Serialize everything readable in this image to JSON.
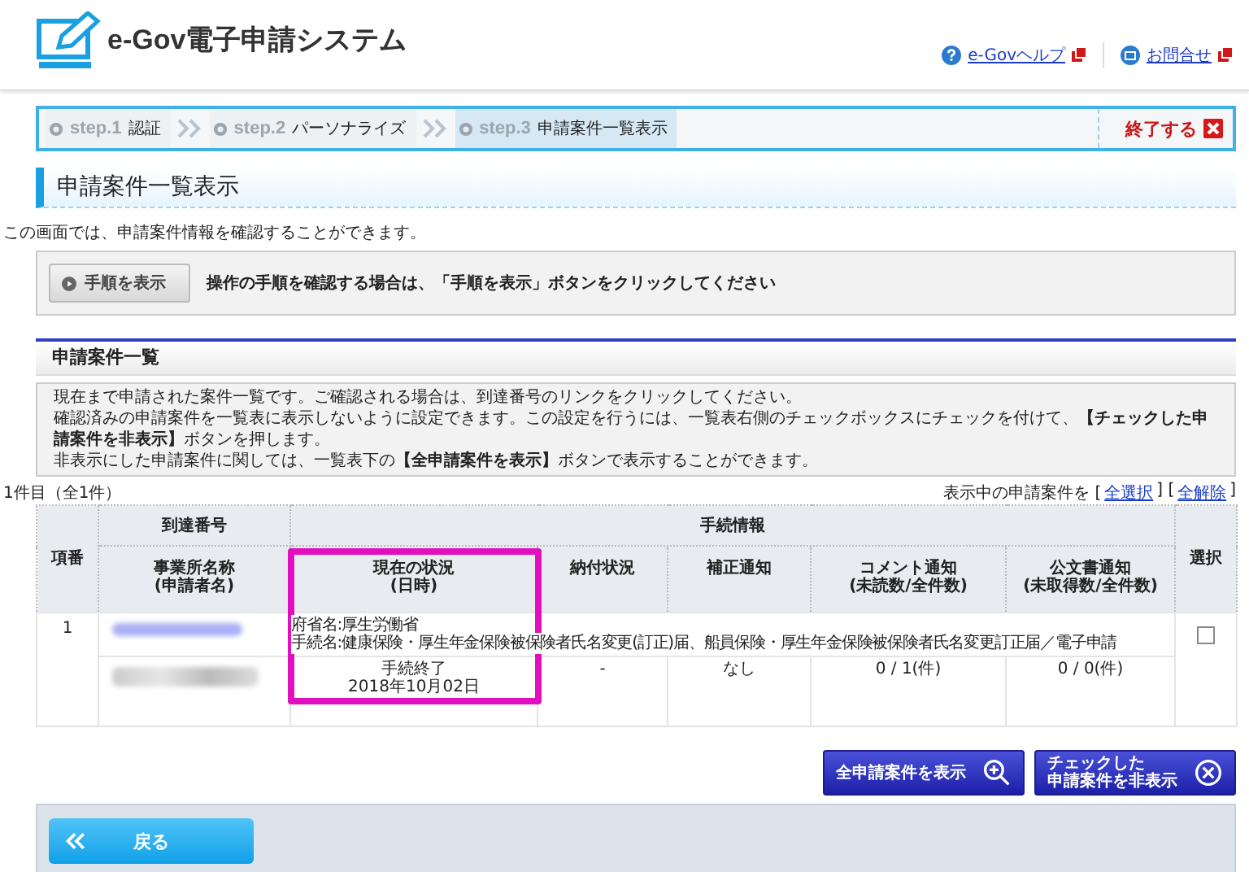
{
  "header": {
    "logo_text": "e-Gov電子申請システム",
    "links": [
      {
        "label": "e-Govヘルプ",
        "kind": "help"
      },
      {
        "label": "お問合せ",
        "kind": "mail"
      }
    ]
  },
  "steps": [
    {
      "number": "step.1",
      "label": "認証",
      "selected": false
    },
    {
      "number": "step.2",
      "label": "パーソナライズ",
      "selected": false
    },
    {
      "number": "step.3",
      "label": "申請案件一覧表示",
      "selected": true
    }
  ],
  "exit_button": "終了する",
  "page_title": "申請案件一覧表示",
  "intro": "この画面では、申請案件情報を確認することができます。",
  "guide": {
    "button": "手順を表示",
    "text": "操作の手順を確認する場合は、「手順を表示」ボタンをクリックしてください"
  },
  "section_title": "申請案件一覧",
  "notice": [
    "現在まで申請された案件一覧です。ご確認される場合は、到達番号のリンクをクリックしてください。",
    "確認済みの申請案件を一覧表に表示しないように設定できます。この設定を行うには、一覧表右側のチェックボックスにチェックを付けて、**【チェックした申請案件を非表示】**ボタンを押します。",
    "非表示にした申請案件に関しては、一覧表下の**【全申請案件を表示】**ボタンで表示することができます。"
  ],
  "count": "1件目（全1件）",
  "selection": {
    "prefix": "表示中の申請案件を [",
    "select_all": "全選択",
    "middle": "] [",
    "clear_all": "全解除",
    "suffix": "]"
  },
  "table": {
    "col_index": "項番",
    "col_arrival": "到達番号",
    "col_procedure": "手続情報",
    "col_select": "選択",
    "sub_columns": [
      "事業所名称\n(申請者名)",
      "現在の状況\n(日時)",
      "納付状況",
      "補正通知",
      "コメント通知\n(未読数/全件数)",
      "公文書通知\n(未取得数/全件数)"
    ],
    "rows": [
      {
        "index": "1",
        "procedure_lines": [
          "府省名:厚生労働省",
          "手続名:健康保険・厚生年金保険被保険者氏名変更(訂正)届、船員保険・厚生年金保険被保険者氏名変更訂正届／電子申請"
        ],
        "cells": [
          "手続終了\n2018年10月02日",
          "-",
          "なし",
          "0 / 1(件)",
          "0 / 0(件)"
        ],
        "checked": false
      }
    ]
  },
  "actions": [
    {
      "label": "全申請案件を表示",
      "kind": "zoom"
    },
    {
      "label": "チェックした",
      "label_2": "申請案件を非表示",
      "kind": "hide"
    }
  ],
  "back_button": "戻る"
}
